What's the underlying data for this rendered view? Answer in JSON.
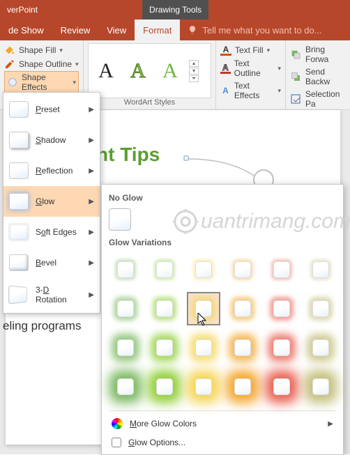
{
  "title_bar": {
    "app": "verPoint",
    "context_tab": "Drawing Tools"
  },
  "tabs": {
    "slideshow": "de Show",
    "review": "Review",
    "view": "View",
    "format": "Format",
    "tellme_placeholder": "Tell me what you want to do..."
  },
  "ribbon": {
    "shape_fill": "Shape Fill",
    "shape_outline": "Shape Outline",
    "shape_effects": "Shape Effects",
    "wordart_label": "WordArt Styles",
    "text_fill": "Text Fill",
    "text_outline": "Text Outline",
    "text_effects": "Text Effects",
    "bring_forward": "Bring Forwa",
    "send_backward": "Send Backw",
    "selection_pane": "Selection Pa"
  },
  "fx_menu": {
    "preset": "reset",
    "shadow": "hadow",
    "reflection": "eflection",
    "glow": "low",
    "soft_edges": "oft Edges",
    "bevel": "evel",
    "rotation": " Rotation"
  },
  "glow_panel": {
    "no_glow": "No Glow",
    "variations": "Glow Variations",
    "more_colors": "More Glow Colors",
    "options": "Glow Options..."
  },
  "glow_colors": [
    "#6ab04c",
    "#82c91e",
    "#f4d03f",
    "#f39c12",
    "#e74c3c",
    "#bdb76b"
  ],
  "glow_strengths": [
    4,
    7,
    11,
    16
  ],
  "slide": {
    "title_fragment": "nt Tips",
    "body_fragment": "eling programs"
  },
  "watermark": "uantrimang.com",
  "hover_cell": {
    "row": 1,
    "col": 2
  }
}
